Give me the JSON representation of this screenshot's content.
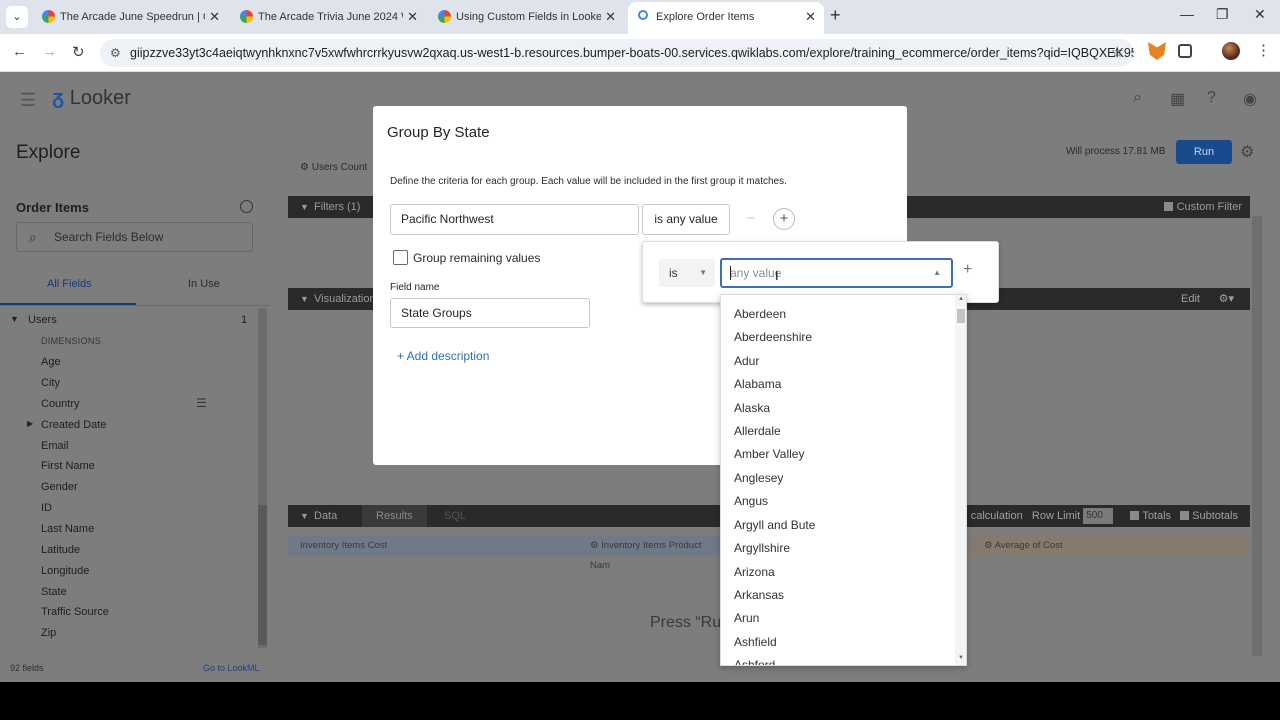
{
  "browser": {
    "tabs": [
      {
        "title": "The Arcade June Speedrun | Go"
      },
      {
        "title": "The Arcade Trivia June 2024 We"
      },
      {
        "title": "Using Custom Fields in Looker"
      },
      {
        "title": "Explore Order Items"
      }
    ],
    "url": "giipzzve33yt3c4aeiqtwynhknxnc7v5xwfwhrcrrkyusvw2qxaq.us-west1-b.resources.bumper-boats-00.services.qwiklabs.com/explore/training_ecommerce/order_items?qid=IQBQXEK95GAFyC..."
  },
  "header": {
    "logo": "Looker"
  },
  "explore": {
    "title": "Explore",
    "process_text": "Will process 17.81 MB",
    "run_label": "Run"
  },
  "sidebar": {
    "title": "Order Items",
    "search_placeholder": "Search Fields Below",
    "tab_all": "All Fields",
    "tab_in_use": "In Use",
    "group": "Users",
    "group_count": "1",
    "dimensions_header": "DIMENSIONS",
    "fields": [
      "Age",
      "City",
      "Country",
      "Created Date",
      "Email",
      "First Name",
      "Gender",
      "ID",
      "Last Name",
      "Latitude",
      "Longitude",
      "State",
      "Traffic Source",
      "Zip"
    ],
    "footer_count": "92 fields",
    "footer_link": "Go to LookML"
  },
  "main": {
    "filters_label": "Filters (1)",
    "custom_filter": "Custom Filter",
    "users_count": "Users Count",
    "visualization_label": "Visualization",
    "edit_label": "Edit",
    "data_label": "Data",
    "results_label": "Results",
    "sql_label": "SQL",
    "add_calc": "dd calculation",
    "row_limit": "Row Limit",
    "row_limit_value": "500",
    "totals": "Totals",
    "subtotals": "Subtotals",
    "col_1": "Inventory Items Cost",
    "col_2": "Inventory Items Product Nam",
    "col_3": "Average of Cost",
    "press_run": "Press “Ru"
  },
  "modal": {
    "title": "Group By State",
    "description": "Define the criteria for each group. Each value will be included in the first group it matches.",
    "group_name": "Pacific Northwest",
    "condition": "is any value",
    "remaining_label": "Group remaining values",
    "field_name_label": "Field name",
    "field_name_value": "State Groups",
    "add_description": "+ Add description"
  },
  "popover": {
    "operator": "is",
    "value_placeholder": "any value"
  },
  "dropdown": {
    "options": [
      "Aberdeen",
      "Aberdeenshire",
      "Adur",
      "Alabama",
      "Alaska",
      "Allerdale",
      "Amber Valley",
      "Anglesey",
      "Angus",
      "Argyll and Bute",
      "Argyllshire",
      "Arizona",
      "Arkansas",
      "Arun",
      "Ashfield",
      "Ashford"
    ]
  }
}
